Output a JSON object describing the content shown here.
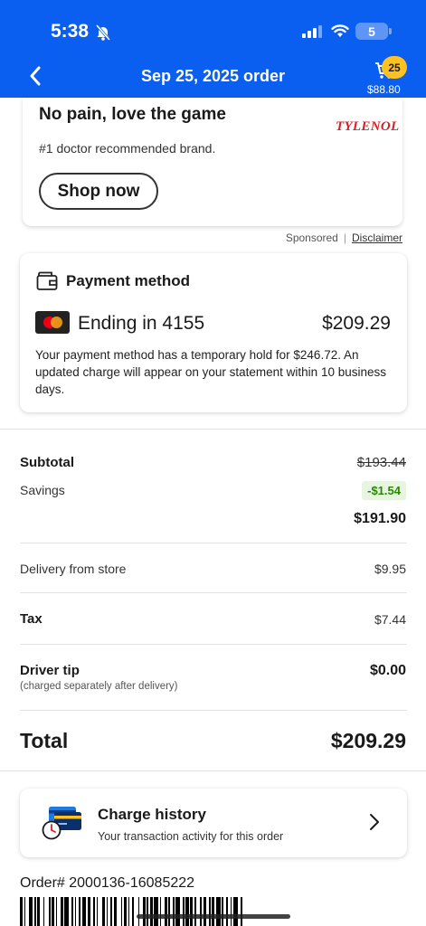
{
  "status_bar": {
    "time": "5:38",
    "battery": "5"
  },
  "header": {
    "title": "Sep 25, 2025 order",
    "cart_count": "25",
    "cart_total": "$88.80"
  },
  "ad": {
    "headline": "No pain, love the game",
    "subtext": "#1 doctor recommended brand.",
    "brand": "TYLENOL",
    "cta": "Shop now",
    "sponsored": "Sponsored",
    "separator": "|",
    "disclaimer": "Disclaimer"
  },
  "payment": {
    "title": "Payment method",
    "card_ending": "Ending in 4155",
    "amount": "$209.29",
    "note": "Your payment method has a temporary hold for $246.72. An updated charge will appear on your statement within 10 business days."
  },
  "summary": {
    "subtotal_label": "Subtotal",
    "subtotal_original": "$193.44",
    "savings_label": "Savings",
    "savings_value": "-$1.54",
    "subtotal_final": "$191.90",
    "delivery_label": "Delivery from store",
    "delivery_value": "$9.95",
    "tax_label": "Tax",
    "tax_value": "$7.44",
    "tip_label": "Driver tip",
    "tip_note": "(charged separately after delivery)",
    "tip_value": "$0.00",
    "total_label": "Total",
    "total_value": "$209.29"
  },
  "charge_history": {
    "title": "Charge history",
    "subtitle": "Your transaction activity for this order"
  },
  "order": {
    "number": "Order# 2000136-16085222"
  },
  "colors": {
    "brand_blue": "#0a5ef0",
    "cart_badge": "#ffc220",
    "savings_green": "#2a8703",
    "tylenol_red": "#d2232a"
  }
}
